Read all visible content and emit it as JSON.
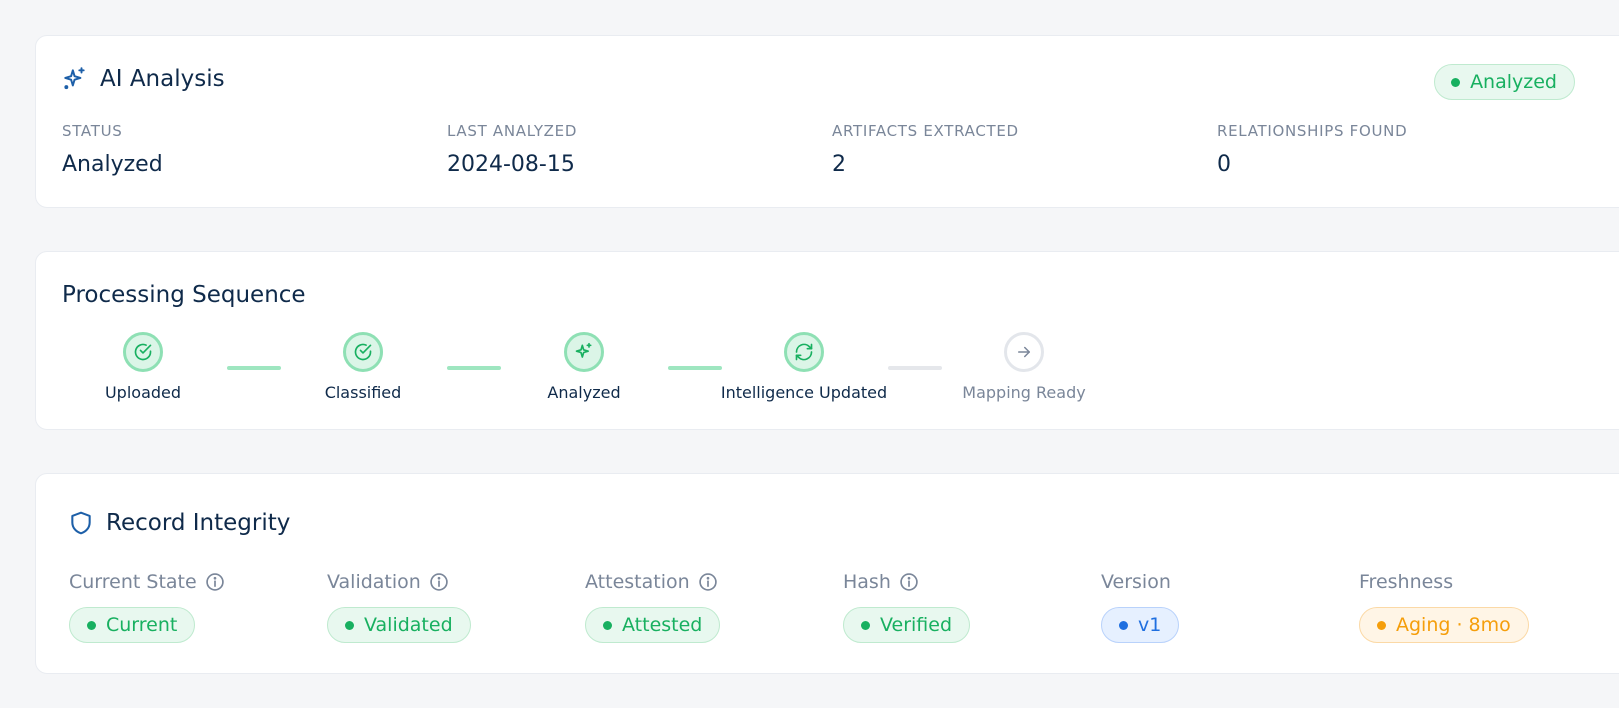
{
  "ai_analysis": {
    "title": "AI Analysis",
    "badge": "Analyzed",
    "stats": [
      {
        "label": "STATUS",
        "value": "Analyzed"
      },
      {
        "label": "LAST ANALYZED",
        "value": "2024-08-15"
      },
      {
        "label": "ARTIFACTS EXTRACTED",
        "value": "2"
      },
      {
        "label": "RELATIONSHIPS FOUND",
        "value": "0"
      }
    ]
  },
  "sequence": {
    "title": "Processing Sequence",
    "steps": [
      {
        "label": "Uploaded",
        "state": "complete",
        "icon": "check-circle-icon"
      },
      {
        "label": "Classified",
        "state": "complete",
        "icon": "check-circle-icon"
      },
      {
        "label": "Analyzed",
        "state": "complete",
        "icon": "sparkle-icon"
      },
      {
        "label": "Intelligence Updated",
        "state": "complete",
        "icon": "refresh-icon"
      },
      {
        "label": "Mapping Ready",
        "state": "pending",
        "icon": "arrow-right-icon"
      }
    ]
  },
  "integrity": {
    "title": "Record Integrity",
    "columns": [
      {
        "label": "Current State",
        "info": true,
        "pill": "Current",
        "tone": "green"
      },
      {
        "label": "Validation",
        "info": true,
        "pill": "Validated",
        "tone": "green"
      },
      {
        "label": "Attestation",
        "info": true,
        "pill": "Attested",
        "tone": "green"
      },
      {
        "label": "Hash",
        "info": true,
        "pill": "Verified",
        "tone": "green"
      },
      {
        "label": "Version",
        "info": false,
        "pill": "v1",
        "tone": "blue"
      },
      {
        "label": "Freshness",
        "info": false,
        "pill": "Aging · 8mo",
        "tone": "orange"
      }
    ]
  },
  "colors": {
    "green": "#18b060",
    "blue": "#1f6fe0",
    "orange": "#f59e0b",
    "step_done_line": "#9ee6c0",
    "step_pending_line": "#e5e7eb",
    "navy": "#0f2a4a"
  }
}
